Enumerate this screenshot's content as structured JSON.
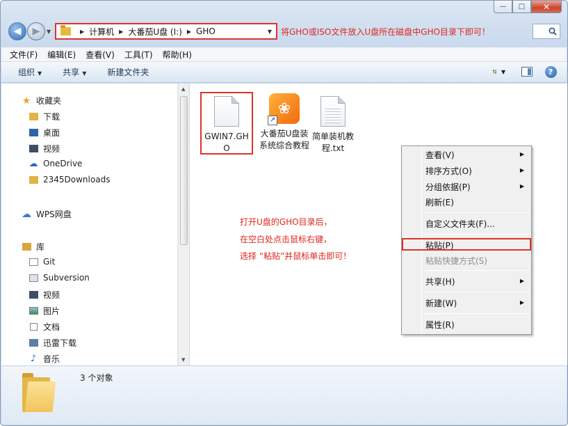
{
  "window": {
    "caption": {
      "minimize": "—",
      "maximize": "□",
      "close": "✕"
    }
  },
  "address": {
    "crumbs": [
      "计算机",
      "大番茄U盘 (I:)",
      "GHO"
    ],
    "note": "将GHO或ISO文件放入U盘所在磁盘中GHO目录下即可！"
  },
  "menubar": [
    "文件(F)",
    "编辑(E)",
    "查看(V)",
    "工具(T)",
    "帮助(H)"
  ],
  "toolbar": {
    "organize": "组织",
    "share": "共享",
    "new_folder": "新建文件夹"
  },
  "nav": {
    "favorites_header": "收藏夹",
    "favorites": [
      "下载",
      "桌面",
      "视频",
      "OneDrive",
      "2345Downloads"
    ],
    "wps": "WPS网盘",
    "library_header": "库",
    "library": [
      "Git",
      "Subversion",
      "视频",
      "图片",
      "文档",
      "迅雷下载",
      "音乐"
    ]
  },
  "files": [
    {
      "name": "GWIN7.GHO",
      "icon": "document-icon"
    },
    {
      "name": "大番茄U盘装系统综合教程",
      "icon": "app-shortcut-icon"
    },
    {
      "name": "简单装机教程.txt",
      "icon": "text-file-icon"
    }
  ],
  "instructions": [
    "打开U盘的GHO目录后，",
    "在空白处点击鼠标右键，",
    "选择 “粘贴”并鼠标单击即可！"
  ],
  "context_menu": {
    "view": "查看(V)",
    "sort": "排序方式(O)",
    "group": "分组依据(P)",
    "refresh": "刷新(E)",
    "customize": "自定义文件夹(F)...",
    "paste": "粘贴(P)",
    "paste_shortcut": "粘贴快捷方式(S)",
    "share": "共享(H)",
    "new": "新建(W)",
    "properties": "属性(R)"
  },
  "details": {
    "count": "3 个对象"
  },
  "colors": {
    "highlight_red": "#e0312a",
    "note_red": "#e0251d",
    "toolbar_text": "#1e395b"
  }
}
